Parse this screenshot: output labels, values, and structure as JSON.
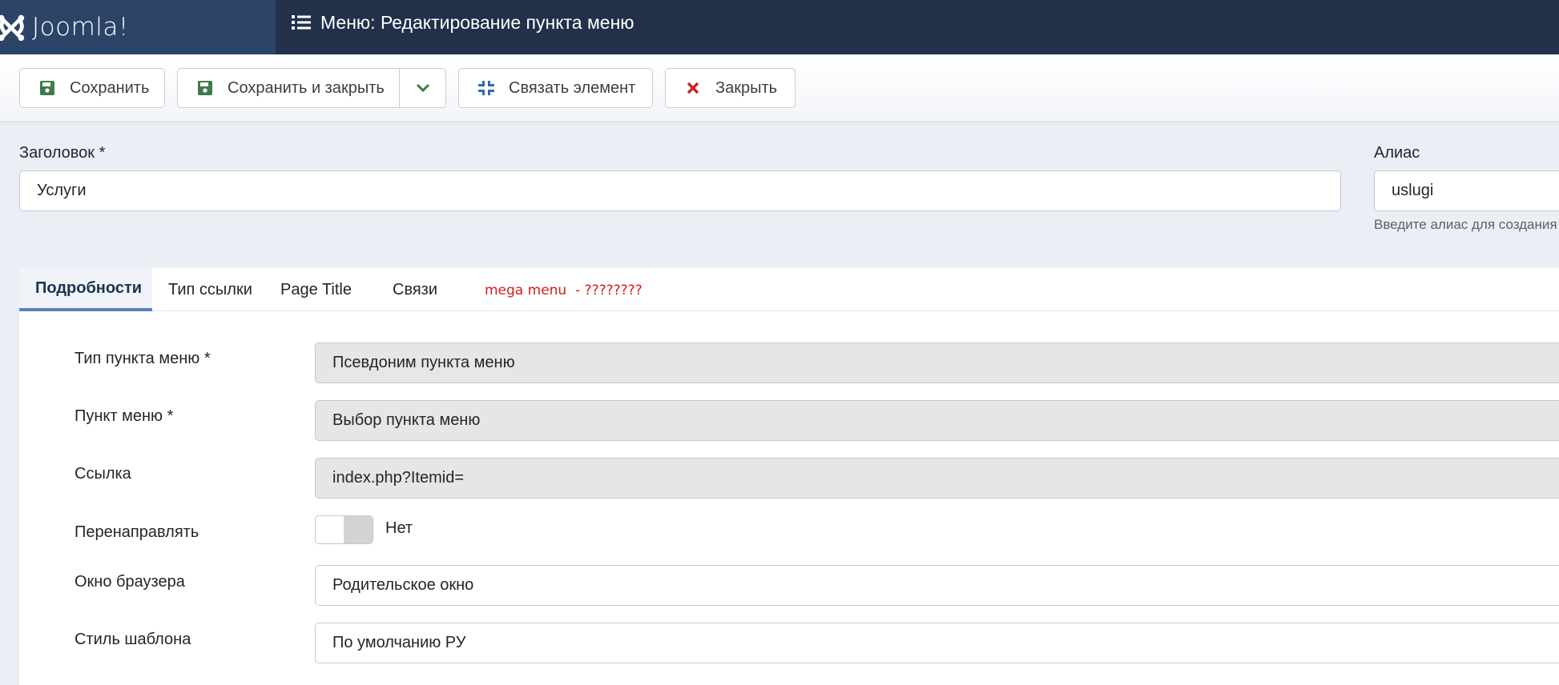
{
  "header": {
    "brand": "Joomla!",
    "title": "Меню: Редактирование пункта меню",
    "title_icon": "list-icon"
  },
  "toolbar": {
    "save": {
      "label": "Сохранить",
      "icon": "save-icon"
    },
    "save_close": {
      "label": "Сохранить и закрыть",
      "icon": "save-icon",
      "dropdown_icon": "chevron-down-icon"
    },
    "associate": {
      "label": "Связать элемент",
      "icon": "compress-icon"
    },
    "close": {
      "label": "Закрыть",
      "icon": "close-icon"
    }
  },
  "title_field": {
    "label": "Заголовок *",
    "value": "Услуги"
  },
  "alias_field": {
    "label": "Алиас",
    "value": "uslugi",
    "help": "Введите алиас для создания"
  },
  "tabs": [
    {
      "label": "Подробности",
      "active": true
    },
    {
      "label": "Тип ссылки",
      "active": false
    },
    {
      "label": "Page Title",
      "active": false
    },
    {
      "label": "Связи",
      "active": false
    }
  ],
  "tab_note": "mega menu  - ????????",
  "details": {
    "menu_item_type": {
      "label": "Тип пункта меню *",
      "value": "Псевдоним пункта меню"
    },
    "menu_item": {
      "label": "Пункт меню *",
      "value": "Выбор пункта меню"
    },
    "link": {
      "label": "Ссылка",
      "value": "index.php?Itemid="
    },
    "redirect": {
      "label": "Перенаправлять",
      "value": "Нет",
      "on": false
    },
    "browser_window": {
      "label": "Окно браузера",
      "value": "Родительское окно"
    },
    "template_style": {
      "label": "Стиль шаблона",
      "value": "По умолчанию РУ"
    }
  },
  "colors": {
    "header_bg": "#22304a",
    "logo_bg": "#2c4467",
    "save_icon": "#3f7b4c",
    "associate_icon": "#2f6bb0",
    "close_icon": "#c52727",
    "tab_active_border": "#5a84b8",
    "note_text": "#d51a1a"
  }
}
